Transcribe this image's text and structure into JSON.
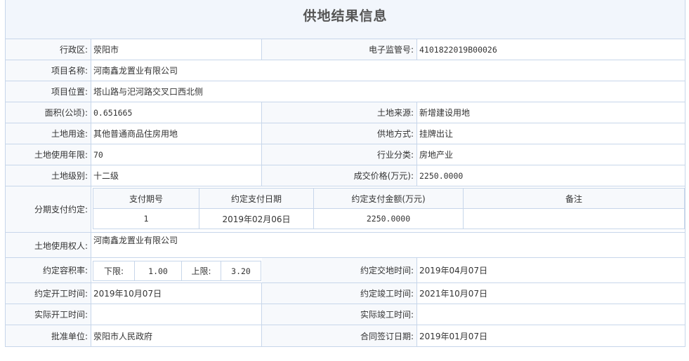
{
  "title": "供地结果信息",
  "fields": {
    "district_label": "行政区:",
    "district": "荥阳市",
    "supervision_no_label": "电子监管号:",
    "supervision_no": "4101822019B00026",
    "project_name_label": "项目名称:",
    "project_name": "河南鑫龙置业有限公司",
    "location_label": "项目位置:",
    "location": "塔山路与汜河路交叉口西北侧",
    "area_label": "面积(公顷):",
    "area": "0.651665",
    "land_source_label": "土地来源:",
    "land_source": "新增建设用地",
    "land_use_label": "土地用途:",
    "land_use": "其他普通商品住房用地",
    "supply_method_label": "供地方式:",
    "supply_method": "挂牌出让",
    "use_years_label": "土地使用年限:",
    "use_years": "70",
    "industry_label": "行业分类:",
    "industry": "房地产业",
    "land_grade_label": "土地级别:",
    "land_grade": "十二级",
    "price_label": "成交价格(万元):",
    "price": "2250.0000",
    "installment_label": "分期支付约定:",
    "land_user_label": "土地使用权人:",
    "land_user": "河南鑫龙置业有限公司",
    "plot_ratio_label": "约定容积率:",
    "lower_label": "下限:",
    "lower": "1.00",
    "upper_label": "上限:",
    "upper": "3.20",
    "handover_label": "约定交地时间:",
    "handover": "2019年04月07日",
    "start_label": "约定开工时间:",
    "start": "2019年10月07日",
    "complete_label": "约定竣工时间:",
    "complete": "2021年10月07日",
    "actual_start_label": "实际开工时间:",
    "actual_start": "",
    "actual_complete_label": "实际竣工时间:",
    "actual_complete": "",
    "approver_label": "批准单位:",
    "approver": "荥阳市人民政府",
    "contract_date_label": "合同签订日期:",
    "contract_date": "2019年01月07日"
  },
  "payment_table": {
    "headers": [
      "支付期号",
      "约定支付日期",
      "约定支付金额(万元)",
      "备注"
    ],
    "rows": [
      [
        "1",
        "2019年02月06日",
        "2250.0000",
        ""
      ]
    ]
  }
}
